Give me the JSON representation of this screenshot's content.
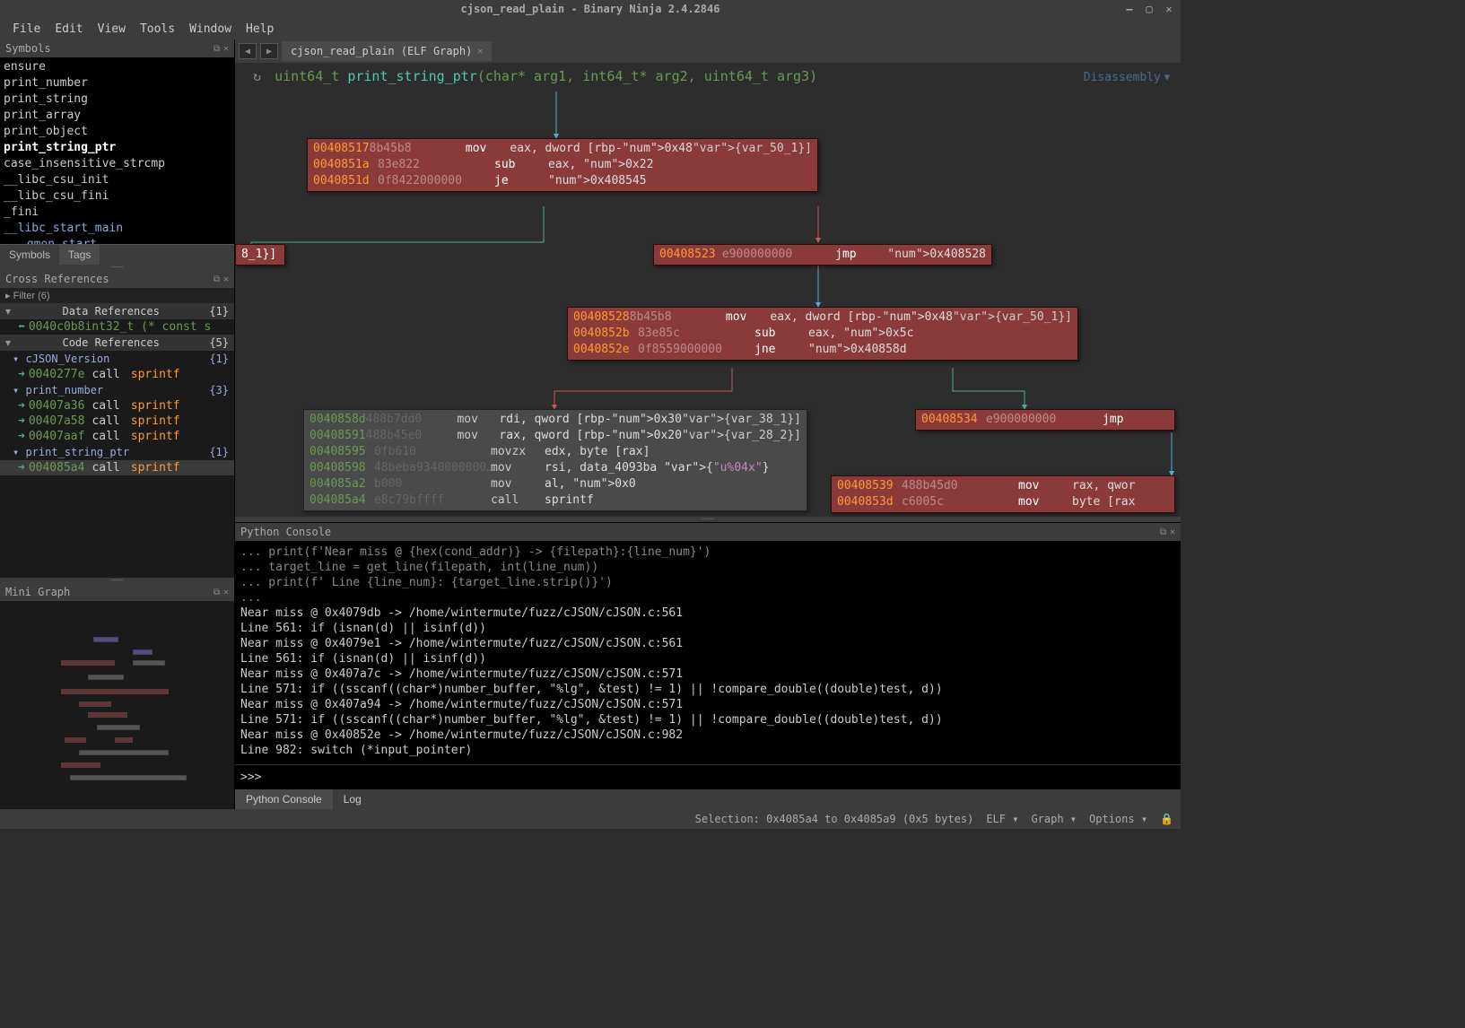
{
  "window_title": "cjson_read_plain - Binary Ninja  2.4.2846",
  "menubar": [
    "File",
    "Edit",
    "View",
    "Tools",
    "Window",
    "Help"
  ],
  "symbols_panel": {
    "title": "Symbols",
    "items": [
      "ensure",
      "print_number",
      "print_string",
      "print_array",
      "print_object",
      "print_string_ptr",
      "case_insensitive_strcmp",
      "__libc_csu_init",
      "__libc_csu_fini",
      "_fini",
      "__libc_start_main",
      "_gmon_start_"
    ],
    "active": "print_string_ptr",
    "tabs": [
      "Symbols",
      "Tags"
    ],
    "active_tab": "Tags"
  },
  "xref_panel": {
    "title": "Cross References",
    "filter": "Filter (6)",
    "data_refs": {
      "label": "Data References",
      "count": "{1}",
      "items": [
        {
          "addr": "0040c0b8",
          "text": "int32_t (* const s"
        }
      ]
    },
    "code_refs": {
      "label": "Code References",
      "count": "{5}",
      "groups": [
        {
          "name": "cJSON_Version",
          "count": "{1}",
          "items": [
            {
              "addr": "0040277e",
              "mnem": "call",
              "fn": "sprintf"
            }
          ]
        },
        {
          "name": "print_number",
          "count": "{3}",
          "items": [
            {
              "addr": "00407a36",
              "mnem": "call",
              "fn": "sprintf"
            },
            {
              "addr": "00407a58",
              "mnem": "call",
              "fn": "sprintf"
            },
            {
              "addr": "00407aaf",
              "mnem": "call",
              "fn": "sprintf"
            }
          ]
        },
        {
          "name": "print_string_ptr",
          "count": "{1}",
          "items": [
            {
              "addr": "004085a4",
              "mnem": "call",
              "fn": "sprintf",
              "selected": true
            }
          ]
        }
      ]
    }
  },
  "minigraph_title": "Mini Graph",
  "tab_label": "cjson_read_plain (ELF Graph)",
  "signature": {
    "ret": "uint64_t",
    "name": "print_string_ptr",
    "params": "(char* arg1, int64_t* arg2, uint64_t arg3)"
  },
  "disasm_mode": "Disassembly",
  "blocks": {
    "b1": [
      [
        "00408517",
        "8b45b8",
        "mov",
        "eax, dword [rbp-0x48 {var_50_1}]"
      ],
      [
        "0040851a",
        "83e822",
        "sub",
        "eax, 0x22"
      ],
      [
        "0040851d",
        "0f8422000000",
        "je",
        "0x408545"
      ]
    ],
    "b2": [
      [
        "00408523",
        "e900000000",
        "jmp",
        "0x408528"
      ]
    ],
    "b3": [
      [
        "00408528",
        "8b45b8",
        "mov",
        "eax, dword [rbp-0x48 {var_50_1}]"
      ],
      [
        "0040852b",
        "83e85c",
        "sub",
        "eax, 0x5c"
      ],
      [
        "0040852e",
        "0f8559000000",
        "jne",
        "0x40858d"
      ]
    ],
    "b4": [
      [
        "0040858d",
        "488b7dd0",
        "mov",
        "rdi, qword [rbp-0x30 {var_38_1}]"
      ],
      [
        "00408591",
        "488b45e0",
        "mov",
        "rax, qword [rbp-0x20 {var_28_2}]"
      ],
      [
        "00408595",
        "0fb610",
        "movzx",
        "edx, byte [rax]"
      ],
      [
        "00408598",
        "48beba9340000000…",
        "mov",
        "rsi, data_4093ba   {\"u%04x\"}"
      ],
      [
        "004085a2",
        "b000",
        "mov",
        "al, 0x0"
      ],
      [
        "004085a4",
        "e8c79bffff",
        "call",
        "sprintf"
      ]
    ],
    "b5": [
      [
        "00408534",
        "e900000000",
        "jmp",
        ""
      ]
    ],
    "b6": [
      [
        "00408539",
        "488b45d0",
        "mov",
        "rax, qwor"
      ],
      [
        "0040853d",
        "c6005c",
        "mov",
        "byte [rax"
      ]
    ],
    "partial": "8_1}]"
  },
  "console": {
    "title": "Python Console",
    "lines": [
      "...         print(f'Near miss @ {hex(cond_addr)} -> {filepath}:{line_num}')",
      "...         target_line = get_line(filepath, int(line_num))",
      "...         print(f'  Line {line_num}: {target_line.strip()}')",
      "...",
      "Near miss @ 0x4079db -> /home/wintermute/fuzz/cJSON/cJSON.c:561",
      "  Line 561: if (isnan(d) || isinf(d))",
      "Near miss @ 0x4079e1 -> /home/wintermute/fuzz/cJSON/cJSON.c:561",
      "  Line 561: if (isnan(d) || isinf(d))",
      "Near miss @ 0x407a7c -> /home/wintermute/fuzz/cJSON/cJSON.c:571",
      "  Line 571: if ((sscanf((char*)number_buffer, \"%lg\", &test) != 1) || !compare_double((double)test, d))",
      "Near miss @ 0x407a94 -> /home/wintermute/fuzz/cJSON/cJSON.c:571",
      "  Line 571: if ((sscanf((char*)number_buffer, \"%lg\", &test) != 1) || !compare_double((double)test, d))",
      "Near miss @ 0x40852e -> /home/wintermute/fuzz/cJSON/cJSON.c:982",
      "  Line 982: switch (*input_pointer)"
    ],
    "prompt": ">>>",
    "tabs": [
      "Python Console",
      "Log"
    ]
  },
  "status": {
    "selection": "Selection: 0x4085a4 to 0x4085a9 (0x5 bytes)",
    "elf": "ELF ▾",
    "graph": "Graph ▾",
    "options": "Options ▾"
  }
}
